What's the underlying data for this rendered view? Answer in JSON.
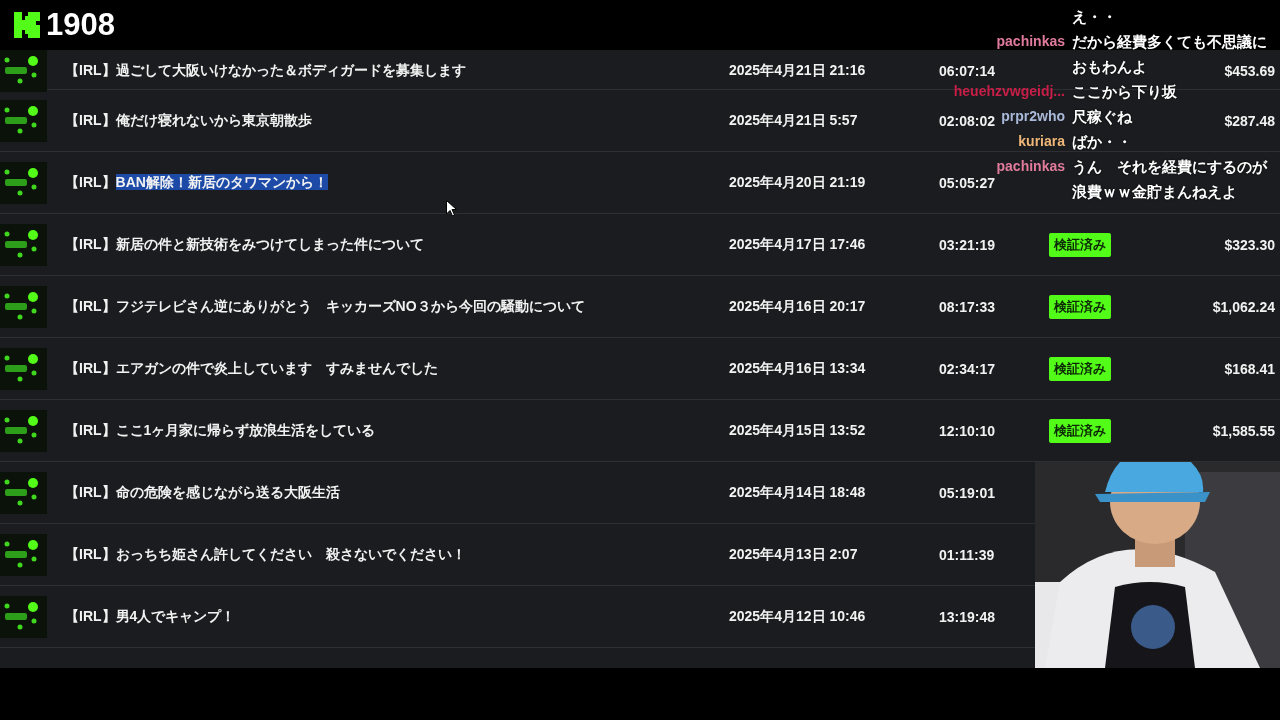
{
  "header": {
    "count": "1908"
  },
  "videos": [
    {
      "tag": "【IRL】",
      "title": "過ごして大阪いけなかった＆ボディガードを募集します",
      "highlighted": false,
      "date": "2025年4月21日 21:16",
      "duration": "06:07:14",
      "amount": "$453.69"
    },
    {
      "tag": "【IRL】",
      "title": "俺だけ寝れないから東京朝散歩",
      "highlighted": false,
      "date": "2025年4月21日 5:57",
      "duration": "02:08:02",
      "amount": "$287.48"
    },
    {
      "tag": "【IRL】",
      "title": "BAN解除！新居のタワマンから！",
      "highlighted": true,
      "date": "2025年4月20日 21:19",
      "duration": "05:05:27"
    },
    {
      "tag": "【IRL】",
      "title": "新居の件と新技術をみつけてしまった件について",
      "highlighted": false,
      "date": "2025年4月17日 17:46",
      "duration": "03:21:19",
      "status": "検証済み",
      "amount": "$323.30"
    },
    {
      "tag": "【IRL】",
      "title": "フジテレビさん逆にありがとう　キッカーズNO３から今回の騒動について",
      "highlighted": false,
      "date": "2025年4月16日 20:17",
      "duration": "08:17:33",
      "status": "検証済み",
      "amount": "$1,062.24"
    },
    {
      "tag": "【IRL】",
      "title": "エアガンの件で炎上しています　すみませんでした",
      "highlighted": false,
      "date": "2025年4月16日 13:34",
      "duration": "02:34:17",
      "status": "検証済み",
      "amount": "$168.41"
    },
    {
      "tag": "【IRL】",
      "title": "ここ1ヶ月家に帰らず放浪生活をしている",
      "highlighted": false,
      "date": "2025年4月15日 13:52",
      "duration": "12:10:10",
      "status": "検証済み",
      "amount": "$1,585.55"
    },
    {
      "tag": "【IRL】",
      "title": "命の危険を感じながら送る大阪生活",
      "highlighted": false,
      "date": "2025年4月14日 18:48",
      "duration": "05:19:01"
    },
    {
      "tag": "【IRL】",
      "title": "おっちち姫さん許してください　殺さないでください！",
      "highlighted": false,
      "date": "2025年4月13日 2:07",
      "duration": "01:11:39"
    },
    {
      "tag": "【IRL】",
      "title": "男4人でキャンプ！",
      "highlighted": false,
      "date": "2025年4月12日 10:46",
      "duration": "13:19:48"
    }
  ],
  "chat": [
    {
      "lines": [
        "え・・"
      ]
    },
    {
      "name": "pachinkas",
      "color": "#e07b9c",
      "lines": [
        "だから経費多くても不思議に",
        "おもわんよ"
      ]
    },
    {
      "name": "heuehzvwgeidj...",
      "color": "#c81e48",
      "lines": [
        "ここから下り坂"
      ]
    },
    {
      "name": "prpr2who",
      "color": "#a9b9d9",
      "lines": [
        "尺稼ぐね"
      ]
    },
    {
      "name": "kuriara",
      "color": "#f0b878",
      "lines": [
        "ばか・・"
      ]
    },
    {
      "name": "pachinkas",
      "color": "#e07b9c",
      "lines": [
        "うん　それを経費にするのが",
        "浪費ｗｗ金貯まんねえよ"
      ]
    }
  ]
}
